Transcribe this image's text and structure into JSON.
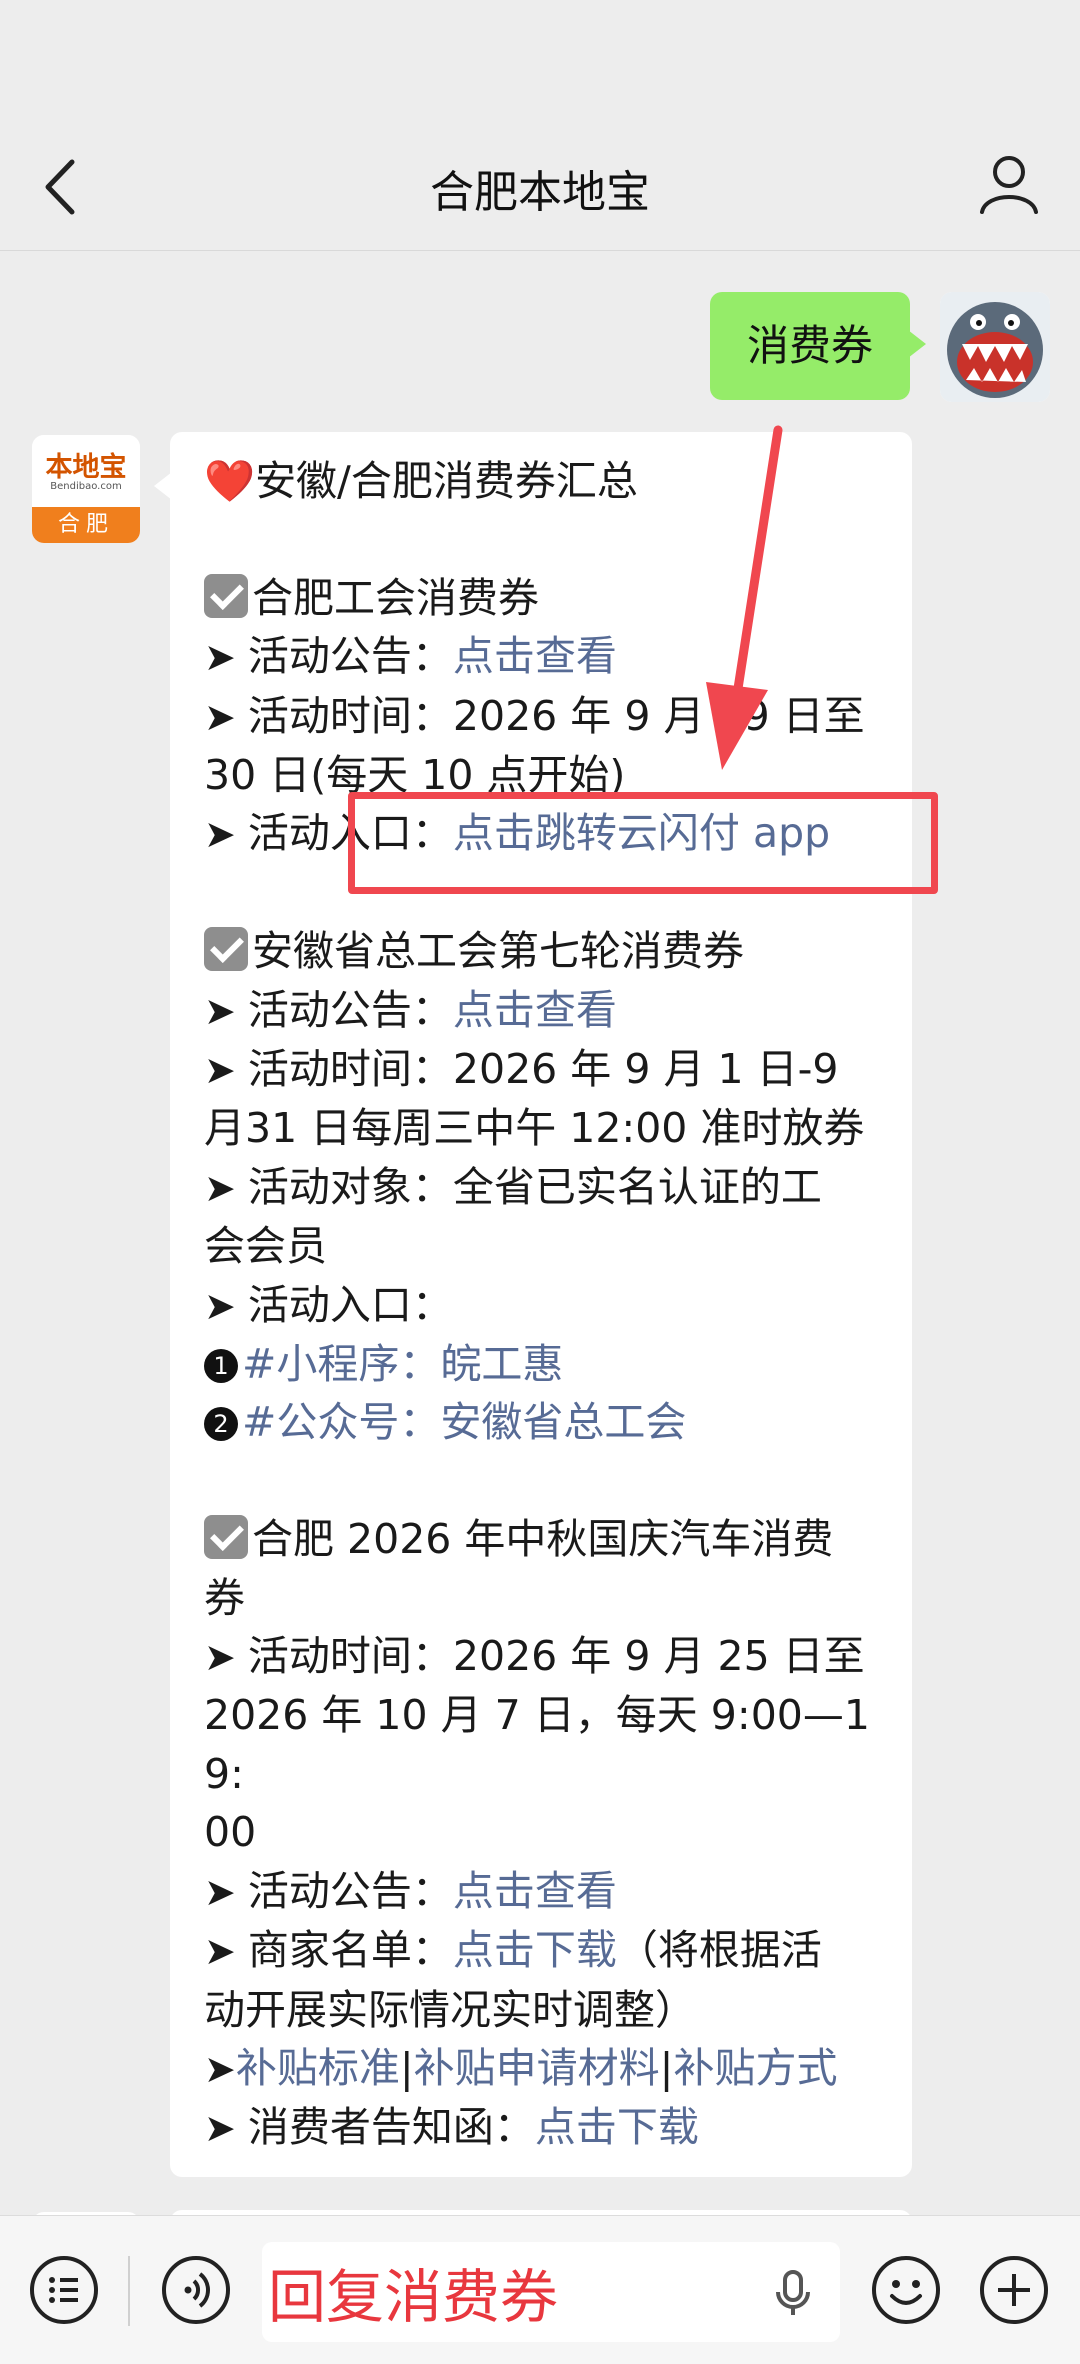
{
  "header": {
    "title": "合肥本地宝"
  },
  "chat": {
    "user_message": "消费券",
    "bot_avatar": {
      "brand": "本地宝",
      "site": "Bendibao.com",
      "city": "合肥"
    }
  },
  "card": {
    "heading": "安徽/合肥消费券汇总",
    "sections": [
      {
        "title": "合肥工会消费券",
        "notice_label": "活动公告：",
        "notice_link": "点击查看",
        "time_label": "活动时间：",
        "time_text_1": "2026 年 9 月 29 日至",
        "time_text_2": "30 日(每天 10 点开始)",
        "entry_label": "活动入口：",
        "entry_link": "点击跳转云闪付 app"
      },
      {
        "title": "安徽省总工会第七轮消费券",
        "notice_label": "活动公告：",
        "notice_link": "点击查看",
        "time_label": "活动时间：",
        "time_text_1": "2026 年 9 月 1 日-9",
        "time_text_2": "月31 日每周三中午 12:00 准时放券",
        "target_label": "活动对象：",
        "target_text_1": "全省已实名认证的工",
        "target_text_2": "会会员",
        "entry_label": "活动入口：",
        "entry_items": [
          {
            "num": "1",
            "text": "#小程序：皖工惠"
          },
          {
            "num": "2",
            "text": "#公众号：安徽省总工会"
          }
        ]
      },
      {
        "title_1": "合肥 2026 年中秋国庆汽车消费",
        "title_2": "券",
        "time_label": "活动时间：",
        "time_text_1": "2026 年 9 月 25 日至",
        "time_text_2": "2026 年 10 月 7 日，每天 9:00—19:",
        "time_text_3": "00",
        "notice_label": "活动公告：",
        "notice_link": "点击查看",
        "merchant_label": "商家名单：",
        "merchant_link": "点击下载",
        "merchant_note_1": "（将根据活",
        "merchant_note_2": "动开展实际情况实时调整）",
        "subsidy_links": [
          "补贴标准",
          "补贴申请材料",
          "补贴方式"
        ],
        "consumer_label": "消费者告知函：",
        "consumer_link": "点击下载"
      }
    ]
  },
  "input": {
    "value": "回复消费券"
  },
  "colors": {
    "link": "#576b95",
    "bubble": "#95ec69",
    "highlight": "#f0474f"
  },
  "icons": [
    "back-arrow-icon",
    "profile-icon",
    "menu-list-icon",
    "voice-icon",
    "microphone-icon",
    "emoji-icon",
    "plus-icon",
    "check-icon",
    "heart-icon"
  ]
}
